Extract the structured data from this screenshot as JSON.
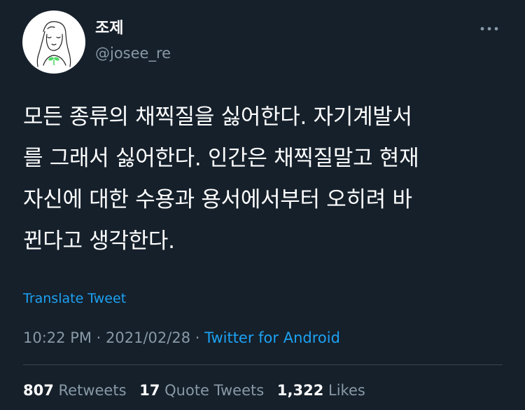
{
  "author": {
    "display_name": "조제",
    "handle": "@josee_re",
    "avatar_icon": "line-art-girl-with-sprout-avatar"
  },
  "menu_icon": "more-horizontal-icon",
  "tweet": {
    "lines": [
      "모든 종류의 채찍질을 싫어한다. 자기계발서",
      "를 그래서 싫어한다. 인간은 채찍질말고 현재",
      "자신에 대한 수용과 용서에서부터 오히려 바",
      "뀐다고 생각한다."
    ]
  },
  "translate_label": "Translate Tweet",
  "meta": {
    "time": "10:22 PM",
    "separator1": " · ",
    "date": "2021/02/28",
    "separator2": " · ",
    "source": "Twitter for Android"
  },
  "stats": {
    "retweets_count": "807",
    "retweets_label": "Retweets",
    "quotes_count": "17",
    "quotes_label": "Quote Tweets",
    "likes_count": "1,322",
    "likes_label": "Likes"
  },
  "colors": {
    "background": "#15202b",
    "text_primary": "#ffffff",
    "text_secondary": "#8899a6",
    "accent": "#1da1f2",
    "divider": "#38444d",
    "sprout": "#4cd964"
  }
}
